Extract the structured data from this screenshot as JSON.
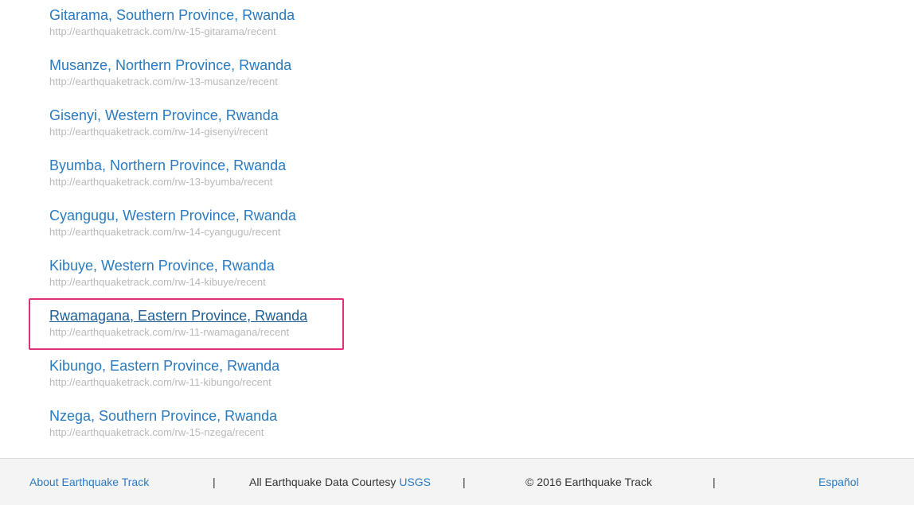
{
  "results": [
    {
      "title": "Gitarama, Southern Province, Rwanda",
      "url": "http://earthquaketrack.com/rw-15-gitarama/recent"
    },
    {
      "title": "Musanze, Northern Province, Rwanda",
      "url": "http://earthquaketrack.com/rw-13-musanze/recent"
    },
    {
      "title": "Gisenyi, Western Province, Rwanda",
      "url": "http://earthquaketrack.com/rw-14-gisenyi/recent"
    },
    {
      "title": "Byumba, Northern Province, Rwanda",
      "url": "http://earthquaketrack.com/rw-13-byumba/recent"
    },
    {
      "title": "Cyangugu, Western Province, Rwanda",
      "url": "http://earthquaketrack.com/rw-14-cyangugu/recent"
    },
    {
      "title": "Kibuye, Western Province, Rwanda",
      "url": "http://earthquaketrack.com/rw-14-kibuye/recent"
    },
    {
      "title": "Rwamagana, Eastern Province, Rwanda",
      "url": "http://earthquaketrack.com/rw-11-rwamagana/recent"
    },
    {
      "title": "Kibungo, Eastern Province, Rwanda",
      "url": "http://earthquaketrack.com/rw-11-kibungo/recent"
    },
    {
      "title": "Nzega, Southern Province, Rwanda",
      "url": "http://earthquaketrack.com/rw-15-nzega/recent"
    }
  ],
  "footer": {
    "about": "About Earthquake Track",
    "courtesy_prefix": "All Earthquake Data Courtesy",
    "usgs": "USGS",
    "copyright": "© 2016 Earthquake Track",
    "language": "Español",
    "separator": "|"
  },
  "colors": {
    "link": "#2a7ac0",
    "url": "#b9b9b9",
    "highlight": "#e0307a",
    "footer_bg": "#f4f4f4"
  }
}
